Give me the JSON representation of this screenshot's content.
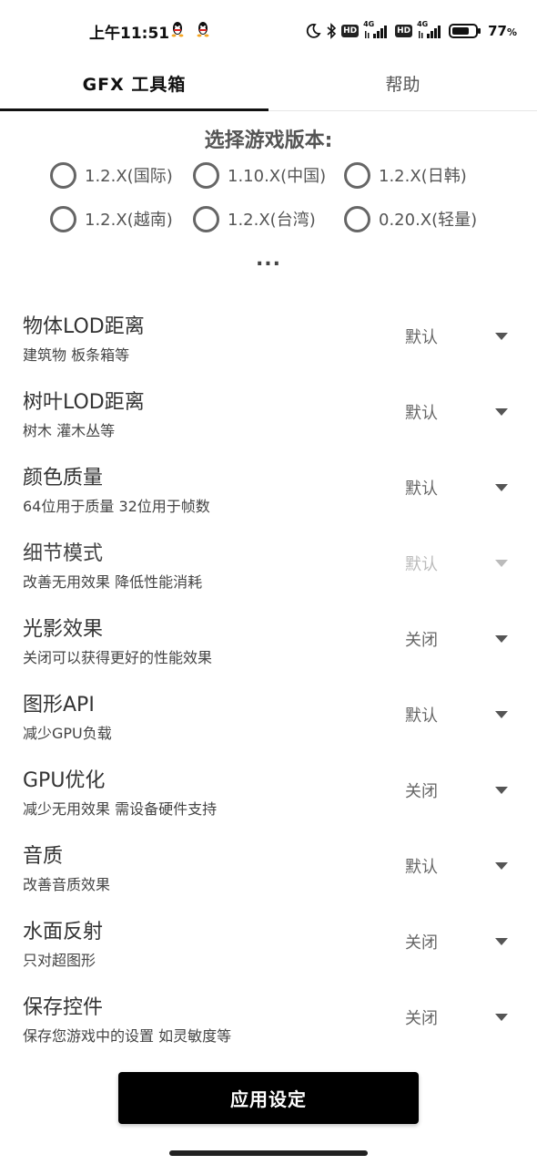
{
  "status_bar": {
    "time": "上午11:51",
    "battery_percent": "77",
    "battery_unit": "%",
    "battery_level": 0.77,
    "hd_labels": [
      "HD",
      "HD"
    ],
    "network_labels": [
      "4G",
      "4G"
    ],
    "icons": [
      "qq-icon",
      "qq-icon",
      "moon-icon",
      "bluetooth-icon",
      "signal-icon",
      "signal-icon",
      "battery-icon"
    ]
  },
  "tabs": [
    {
      "label": "GFX 工具箱",
      "active": true
    },
    {
      "label": "帮助",
      "active": false
    }
  ],
  "version": {
    "title": "选择游戏版本:",
    "options": [
      "1.2.X(国际)",
      "1.10.X(中国)",
      "1.2.X(日韩)",
      "1.2.X(越南)",
      "1.2.X(台湾)",
      "0.20.X(轻量)"
    ],
    "more": "..."
  },
  "settings": [
    {
      "title": "物体LOD距离",
      "subtitle": "建筑物 板条箱等",
      "value": "默认",
      "disabled": false
    },
    {
      "title": "树叶LOD距离",
      "subtitle": "树木 灌木丛等",
      "value": "默认",
      "disabled": false
    },
    {
      "title": "颜色质量",
      "subtitle": "64位用于质量 32位用于帧数",
      "value": "默认",
      "disabled": false
    },
    {
      "title": "细节模式",
      "subtitle": "改善无用效果 降低性能消耗",
      "value": "默认",
      "disabled": true
    },
    {
      "title": "光影效果",
      "subtitle": "关闭可以获得更好的性能效果",
      "value": "关闭",
      "disabled": false
    },
    {
      "title": "图形API",
      "subtitle": "减少GPU负载",
      "value": "默认",
      "disabled": false
    },
    {
      "title": "GPU优化",
      "subtitle": "减少无用效果 需设备硬件支持",
      "value": "关闭",
      "disabled": false
    },
    {
      "title": "音质",
      "subtitle": "改善音质效果",
      "value": "默认",
      "disabled": false
    },
    {
      "title": "水面反射",
      "subtitle": "只对超图形",
      "value": "关闭",
      "disabled": false
    },
    {
      "title": "保存控件",
      "subtitle": "保存您游戏中的设置 如灵敏度等",
      "value": "关闭",
      "disabled": false
    }
  ],
  "apply_button": "应用设定",
  "colors": {
    "accent": "#000000",
    "text": "#333333",
    "disabled": "#bbbbbb"
  }
}
